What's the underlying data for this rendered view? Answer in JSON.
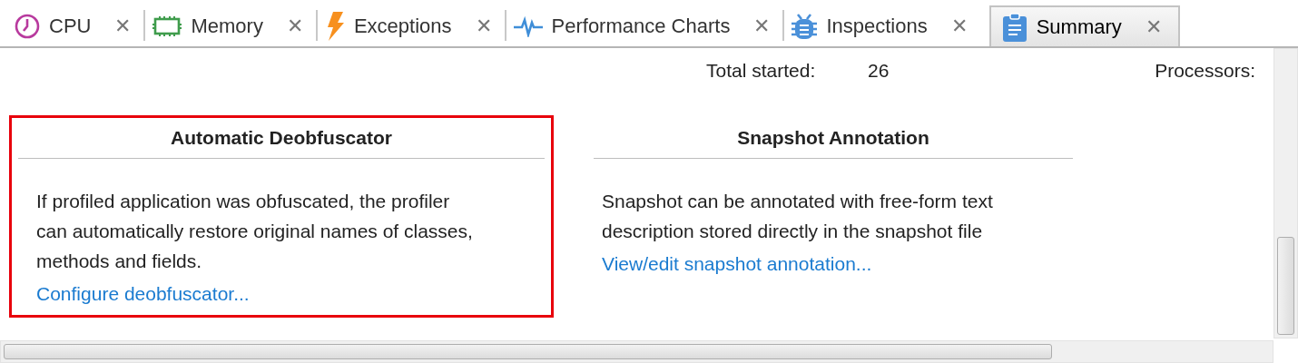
{
  "tabs": [
    {
      "label": "CPU",
      "kind": "cpu",
      "selected": false
    },
    {
      "label": "Memory",
      "kind": "memory",
      "selected": false
    },
    {
      "label": "Exceptions",
      "kind": "exceptions",
      "selected": false
    },
    {
      "label": "Performance Charts",
      "kind": "charts",
      "selected": false
    },
    {
      "label": "Inspections",
      "kind": "inspections",
      "selected": false
    },
    {
      "label": "Summary",
      "kind": "summary",
      "selected": true
    }
  ],
  "close_glyph": "✕",
  "stats": [
    {
      "label": "Total started:",
      "value": "26"
    },
    {
      "label": "Processors:"
    }
  ],
  "cards": [
    {
      "title": "Automatic Deobfuscator",
      "description": "If profiled application was obfuscated, the profiler can automatically restore original names of classes, methods and fields.",
      "link": "Configure deobfuscator...",
      "highlighted": true
    },
    {
      "title": "Snapshot Annotation",
      "description": "Snapshot can be annotated with free-form text description stored directly in the snapshot file",
      "link": "View/edit snapshot annotation...",
      "highlighted": false
    }
  ]
}
